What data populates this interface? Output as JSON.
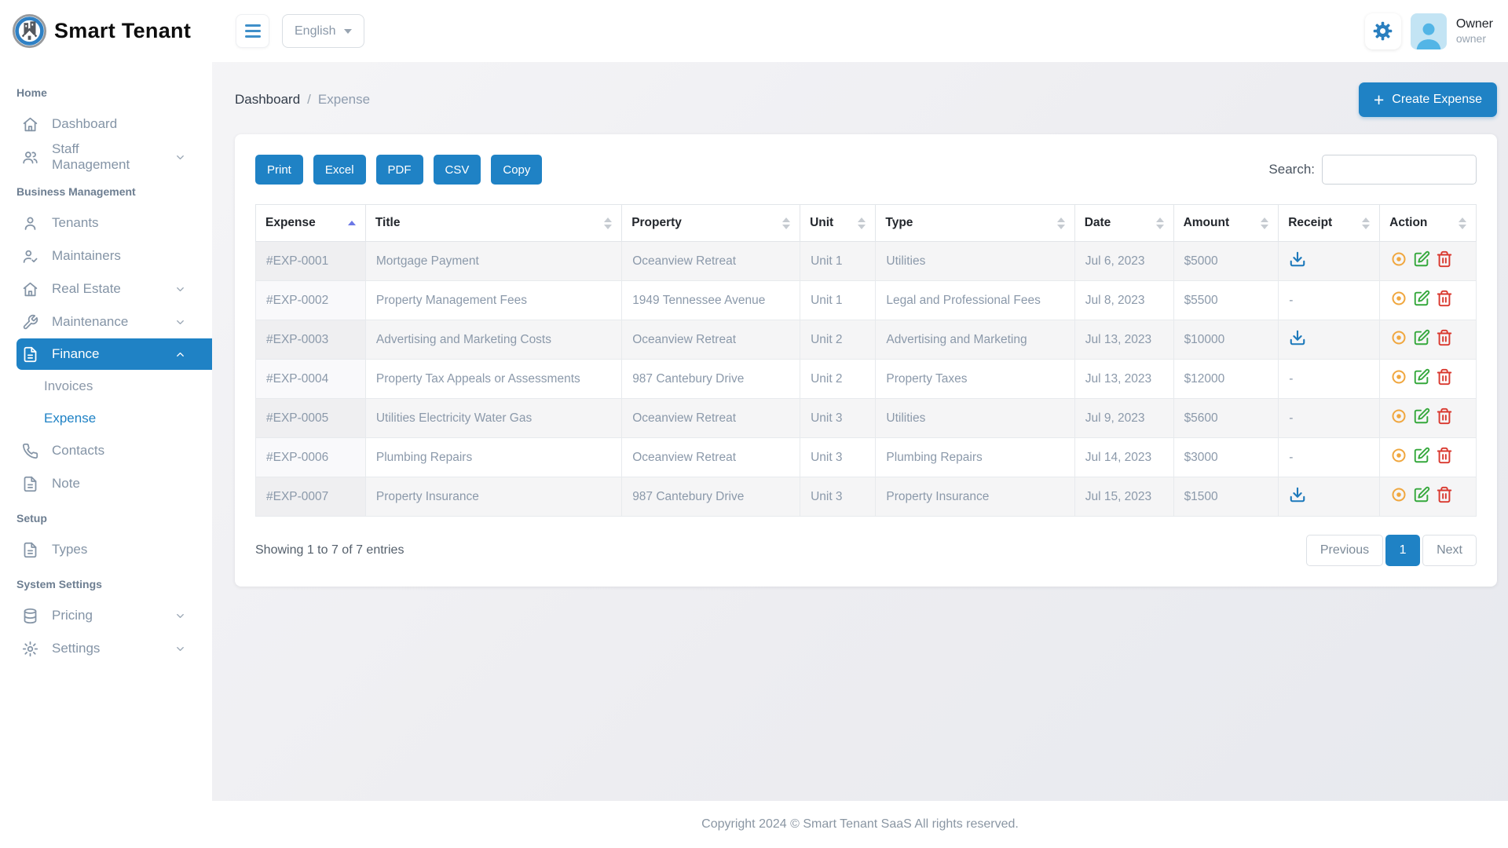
{
  "app": {
    "name": "Smart Tenant"
  },
  "topbar": {
    "language": "English",
    "user": {
      "name": "Owner",
      "role": "owner"
    }
  },
  "sidebar": {
    "items": [
      {
        "type": "section",
        "label": "Home"
      },
      {
        "type": "link",
        "icon": "home-icon",
        "label": "Dashboard"
      },
      {
        "type": "link",
        "icon": "users-icon",
        "label": "Staff Management",
        "chevron": "down"
      },
      {
        "type": "section",
        "label": "Business Management"
      },
      {
        "type": "link",
        "icon": "person-icon",
        "label": "Tenants"
      },
      {
        "type": "link",
        "icon": "person-check-icon",
        "label": "Maintainers"
      },
      {
        "type": "link",
        "icon": "home-icon",
        "label": "Real Estate",
        "chevron": "down"
      },
      {
        "type": "link",
        "icon": "wrench-icon",
        "label": "Maintenance",
        "chevron": "down"
      },
      {
        "type": "link",
        "icon": "document-icon",
        "label": "Finance",
        "chevron": "up",
        "active": true
      },
      {
        "type": "sublink",
        "label": "Invoices"
      },
      {
        "type": "sublink",
        "label": "Expense",
        "active": true
      },
      {
        "type": "link",
        "icon": "phone-icon",
        "label": "Contacts"
      },
      {
        "type": "link",
        "icon": "document-icon",
        "label": "Note"
      },
      {
        "type": "section",
        "label": "Setup"
      },
      {
        "type": "link",
        "icon": "document-icon",
        "label": "Types"
      },
      {
        "type": "section",
        "label": "System Settings"
      },
      {
        "type": "link",
        "icon": "database-icon",
        "label": "Pricing",
        "chevron": "down"
      },
      {
        "type": "link",
        "icon": "gear-icon",
        "label": "Settings",
        "chevron": "down"
      }
    ]
  },
  "breadcrumb": {
    "parent": "Dashboard",
    "separator": "/",
    "current": "Expense"
  },
  "actions": {
    "plus": "+",
    "create_expense": "Create Expense"
  },
  "toolbar": {
    "export_buttons": [
      "Print",
      "Excel",
      "PDF",
      "CSV",
      "Copy"
    ],
    "search_label": "Search:",
    "search_value": ""
  },
  "table": {
    "columns": [
      {
        "label": "Expense",
        "sort": "asc"
      },
      {
        "label": "Title"
      },
      {
        "label": "Property"
      },
      {
        "label": "Unit"
      },
      {
        "label": "Type"
      },
      {
        "label": "Date"
      },
      {
        "label": "Amount"
      },
      {
        "label": "Receipt"
      },
      {
        "label": "Action"
      }
    ],
    "rows": [
      {
        "expense": "#EXP-0001",
        "title": "Mortgage Payment",
        "property": "Oceanview Retreat",
        "unit": "Unit 1",
        "type": "Utilities",
        "date": "Jul 6, 2023",
        "amount": "$5000",
        "receipt": "download"
      },
      {
        "expense": "#EXP-0002",
        "title": "Property Management Fees",
        "property": "1949 Tennessee Avenue",
        "unit": "Unit 1",
        "type": "Legal and Professional Fees",
        "date": "Jul 8, 2023",
        "amount": "$5500",
        "receipt": "-"
      },
      {
        "expense": "#EXP-0003",
        "title": "Advertising and Marketing Costs",
        "property": "Oceanview Retreat",
        "unit": "Unit 2",
        "type": "Advertising and Marketing",
        "date": "Jul 13, 2023",
        "amount": "$10000",
        "receipt": "download"
      },
      {
        "expense": "#EXP-0004",
        "title": "Property Tax Appeals or Assessments",
        "property": "987 Cantebury Drive",
        "unit": "Unit 2",
        "type": "Property Taxes",
        "date": "Jul 13, 2023",
        "amount": "$12000",
        "receipt": "-"
      },
      {
        "expense": "#EXP-0005",
        "title": "Utilities Electricity Water Gas",
        "property": "Oceanview Retreat",
        "unit": "Unit 3",
        "type": "Utilities",
        "date": "Jul 9, 2023",
        "amount": "$5600",
        "receipt": "-"
      },
      {
        "expense": "#EXP-0006",
        "title": "Plumbing Repairs",
        "property": "Oceanview Retreat",
        "unit": "Unit 3",
        "type": "Plumbing Repairs",
        "date": "Jul 14, 2023",
        "amount": "$3000",
        "receipt": "-"
      },
      {
        "expense": "#EXP-0007",
        "title": "Property Insurance",
        "property": "987 Cantebury Drive",
        "unit": "Unit 3",
        "type": "Property Insurance",
        "date": "Jul 15, 2023",
        "amount": "$1500",
        "receipt": "download"
      }
    ]
  },
  "summary": {
    "showing": "Showing 1 to 7 of 7 entries"
  },
  "pagination": {
    "previous": "Previous",
    "current": "1",
    "next": "Next"
  },
  "footer": {
    "copyright": "Copyright 2024 © Smart Tenant SaaS All rights reserved."
  },
  "colors": {
    "primary": "#1f82c5",
    "view_icon": "#f0a73f",
    "edit_icon": "#35a83c",
    "delete_icon": "#d9382e",
    "download_icon": "#1d79bb",
    "sort_active": "#6c78e6"
  }
}
